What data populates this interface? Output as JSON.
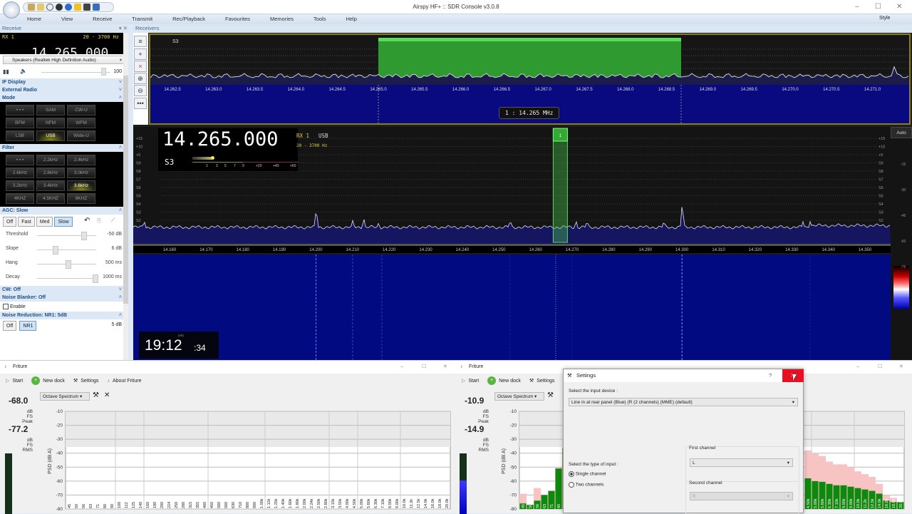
{
  "window": {
    "title": "Airspy HF+ :: SDR Console v3.0.8",
    "style_label": "Style"
  },
  "menu": [
    "Home",
    "View",
    "Receive",
    "Transmit",
    "Rec/Playback",
    "Favourites",
    "Memories",
    "Tools",
    "Help"
  ],
  "receive_panel": {
    "title": "Receive",
    "rx": "RX 1",
    "bandwidth": "20 - 3700 Hz",
    "frequency": "14.265.000",
    "audio_device": "Speakers (Realtek High Definition Audio)",
    "volume": "100",
    "sections": {
      "if_display": "IF Display",
      "external_radio": "External Radio",
      "mode": "Mode",
      "filter": "Filter",
      "agc": "AGC: Slow",
      "cw": "CW: Off",
      "noise_blanker": "Noise Blanker: Off",
      "noise_reduction": "Noise Reduction: NR1: 5dB"
    },
    "modes": [
      {
        "l": "• • •"
      },
      {
        "l": "SAM"
      },
      {
        "l": "CW-U"
      },
      {
        "l": "BFM"
      },
      {
        "l": "NFM"
      },
      {
        "l": "WFM"
      },
      {
        "l": "LSB"
      },
      {
        "l": "USB",
        "on": true
      },
      {
        "l": "Wide-U"
      }
    ],
    "filters": [
      {
        "l": "• • •"
      },
      {
        "l": "2.2kHz"
      },
      {
        "l": "2.4kHz"
      },
      {
        "l": "2.6kHz"
      },
      {
        "l": "2.8kHz"
      },
      {
        "l": "3.0kHz"
      },
      {
        "l": "3.2kHz"
      },
      {
        "l": "3.4kHz"
      },
      {
        "l": "3.6kHz",
        "on": true
      },
      {
        "l": "4KHZ"
      },
      {
        "l": "4.5KHZ"
      },
      {
        "l": "6KHZ"
      }
    ],
    "agc_buttons": [
      {
        "l": "Off"
      },
      {
        "l": "Fast"
      },
      {
        "l": "Med"
      },
      {
        "l": "Slow",
        "on": true
      }
    ],
    "agc_sliders": [
      {
        "l": "Threshold",
        "v": "-50 dB",
        "p": 0.78
      },
      {
        "l": "Slope",
        "v": "6 dB",
        "p": 0.28
      },
      {
        "l": "Hang",
        "v": "500 ms",
        "p": 0.5
      },
      {
        "l": "Decay",
        "v": "1000 ms",
        "p": 0.98
      }
    ],
    "nb_enable": "Enable",
    "nr_buttons": [
      "Off",
      "NR1"
    ],
    "nr_value": "5 dB"
  },
  "receivers": {
    "title": "Receivers",
    "mini_signal": "S3",
    "mini_ticks": [
      "14.262.5",
      "14.263.0",
      "14.263.5",
      "14.264.0",
      "14.264.5",
      "14.265.0",
      "14.265.5",
      "14.266.0",
      "14.266.5",
      "14.267.0",
      "14.267.5",
      "14.268.0",
      "14.268.5",
      "14.269.0",
      "14.269.5",
      "14.270.0",
      "14.270.5",
      "14.271.0"
    ],
    "marker_label": "1 : 14.265 MHz",
    "frequency": "14.265.000",
    "rx": "RX 1",
    "mode": "USB",
    "bandwidth": "20 - 3700 Hz",
    "signal": "S3",
    "smeter_scale": [
      "1",
      "3",
      "5",
      "7",
      "9",
      "+20",
      "+40",
      "+60"
    ],
    "s_levels": [
      "+15",
      "+10",
      "+5",
      "S9",
      "S8",
      "S7",
      "S6",
      "S5",
      "S4",
      "S3",
      "S2",
      "S1"
    ],
    "freq_ticks": [
      "14.160",
      "14.170",
      "14.180",
      "14.190",
      "14.200",
      "14.210",
      "14.220",
      "14.230",
      "14.240",
      "14.250",
      "14.260",
      "14.270",
      "14.280",
      "14.290",
      "14.300",
      "14.310",
      "14.320",
      "14.330",
      "14.340",
      "14.350"
    ],
    "signals": [
      {
        "f": 14.153,
        "s": 2.0
      },
      {
        "f": 14.2,
        "s": 3.6
      },
      {
        "f": 14.21,
        "s": 2.1
      },
      {
        "f": 14.213,
        "s": 2.3
      },
      {
        "f": 14.217,
        "s": 1.7
      },
      {
        "f": 14.253,
        "s": 2.1
      },
      {
        "f": 14.271,
        "s": 2.0
      },
      {
        "f": 14.274,
        "s": 2.0
      },
      {
        "f": 14.295,
        "s": 2.0
      },
      {
        "f": 14.3,
        "s": 4.3
      },
      {
        "f": 14.333,
        "s": 1.9
      },
      {
        "f": 14.335,
        "s": 2.0
      }
    ],
    "rx_marker": "1",
    "auto_label": "Auto",
    "db_scale": [
      "-15",
      "-30",
      "-45",
      "-60",
      "-75"
    ],
    "clock": {
      "label": "UTC",
      "hm": "19:12",
      "s": ":34"
    }
  },
  "friture_left": {
    "title": "Friture",
    "start": "Start",
    "new_dock": "New dock",
    "settings": "Settings",
    "about": "About Friture",
    "peak": "-68.0",
    "peak_label": "dB FS Peak",
    "rms": "-77.2",
    "rms_label": "dB FS RMS",
    "widget": "Octave Spectrum",
    "ylabel": "PSD (dB A)"
  },
  "friture_right": {
    "title": "Friture",
    "start": "Start",
    "new_dock": "New dock",
    "settings": "Settings",
    "peak": "-10.9",
    "peak_label": "dB FS Peak",
    "rms": "-14.9",
    "rms_label": "dB FS RMS",
    "widget": "Octave Spectrum",
    "ylabel": "PSD (dB A)"
  },
  "settings_dialog": {
    "title": "Settings",
    "help": "?",
    "input_device_label": "Select the input device :",
    "input_device": "Line in at rear panel (Blue) (R (2 channels) (MME)  (default)",
    "input_type_label": "Select the type of input :",
    "single": "Single channel",
    "two": "Two channels",
    "first_channel_label": "First channel",
    "first_channel": "L",
    "second_channel_label": "Second channel",
    "second_channel": "R"
  },
  "chart_data": [
    {
      "type": "bar",
      "title": "Octave Spectrum (left)",
      "ylabel": "PSD (dB A)",
      "ylim": [
        -80,
        -10
      ],
      "yticks": [
        "-10",
        "-20",
        "-30",
        "-40",
        "-50",
        "-60",
        "-70",
        "-80"
      ],
      "categories": [
        "45",
        "50",
        "56",
        "63",
        "71",
        "80",
        "90",
        "100",
        "112",
        "125",
        "140",
        "160",
        "180",
        "200",
        "224",
        "250",
        "280",
        "315",
        "355",
        "400",
        "450",
        "500",
        "560",
        "630",
        "710",
        "800",
        "900",
        "1.00k",
        "1.12k",
        "1.25k",
        "1.40k",
        "1.60k",
        "1.80k",
        "2.00k",
        "2.24k",
        "2.50k",
        "2.80k",
        "3.15k",
        "3.55k",
        "4.00k",
        "4.50k",
        "5.00k",
        "5.60k",
        "6.30k",
        "7.10k",
        "8.00k",
        "9.00k",
        "10.0k",
        "11.2k",
        "12.5k",
        "14.0k",
        "16.0k",
        "18.0k",
        "20.0k"
      ],
      "values": []
    },
    {
      "type": "bar",
      "title": "Octave Spectrum (right)",
      "ylabel": "PSD (dB A)",
      "ylim": [
        -80,
        -10
      ],
      "values": [
        -76,
        -77,
        -74,
        -70,
        -67,
        -51,
        -36,
        null,
        null,
        null,
        null,
        null,
        null,
        null,
        null,
        null,
        null,
        null,
        null,
        null,
        null,
        null,
        null,
        null,
        null,
        null,
        null,
        null,
        null,
        null,
        null,
        null,
        null,
        null,
        null,
        null,
        null,
        null,
        null,
        null,
        -58,
        -60,
        -60.5,
        -62,
        -63,
        -63,
        -64,
        -65,
        -66,
        -67,
        -69,
        -74,
        -75,
        -75
      ],
      "peak_hold": [
        -69,
        -77,
        -65,
        -70,
        -67,
        -50,
        -36,
        null,
        null,
        null,
        null,
        null,
        null,
        null,
        null,
        null,
        null,
        null,
        null,
        null,
        null,
        null,
        null,
        null,
        null,
        null,
        null,
        null,
        null,
        null,
        null,
        null,
        null,
        null,
        null,
        null,
        null,
        null,
        null,
        null,
        -38,
        -40,
        -42,
        -46,
        -48,
        -48,
        -50,
        -53,
        -55,
        -57,
        -62,
        -70,
        -72,
        -75
      ]
    }
  ]
}
